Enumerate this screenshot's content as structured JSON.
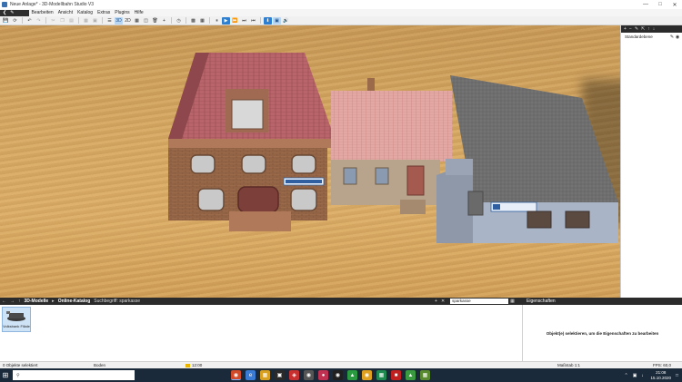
{
  "window": {
    "title": "Neue Anlage* - 3D-Modellbahn Studio V3",
    "controls": [
      "—",
      "□",
      "✕"
    ]
  },
  "menu": {
    "items": [
      "Bearbeiten",
      "Ansicht",
      "Katalog",
      "Extras",
      "Plugins",
      "Hilfe"
    ]
  },
  "toolbar": {
    "buttons": {
      "save": "💾",
      "undo": "↶",
      "redo": "↷",
      "view_3d": "3D",
      "view_2d": "2D",
      "play": "▶",
      "pause": "⏸",
      "fast_forward": "⏩",
      "volume": "🔊"
    }
  },
  "layers_panel": {
    "layer_name": "Standardebene"
  },
  "catalog_bar": {
    "crumb_models": "3D-Modelle",
    "crumb_catalog": "Online-Katalog",
    "search_caption": "Suchbegriff: sparkasse",
    "search_value": "sparkasse",
    "properties_title": "Eigenschaften"
  },
  "catalog": {
    "items": [
      {
        "label": "Volksbank Filiale"
      }
    ]
  },
  "properties": {
    "message": "Objekt(e) selektieren, um die Eigenschaften zu bearbeiten"
  },
  "status": {
    "selection": "0 Objekte selektiert",
    "surface": "Boden",
    "time": "12:00",
    "scale": "Maßstab 1:1",
    "fps": "FPS: 60,0"
  },
  "taskbar": {
    "search_placeholder": "",
    "time": "21:08",
    "date": "15.10.2020"
  },
  "colors": {
    "ground": "#d7aa64",
    "roof_red": "#b8646a",
    "roof_pink": "#e3a8a4",
    "roof_grey": "#6e6e6e",
    "brick": "#9a6a4a",
    "plaster": "#b8a48c",
    "bank_facade": "#a9b4c6",
    "accent": "#2f7fd0"
  }
}
